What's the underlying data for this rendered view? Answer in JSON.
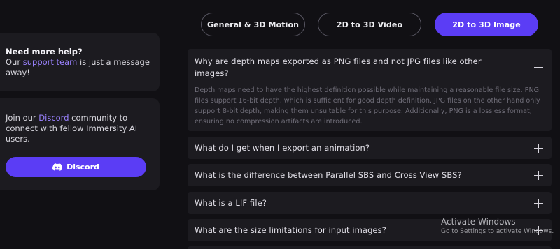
{
  "tabs": [
    {
      "label": "General & 3D Motion",
      "active": false
    },
    {
      "label": "2D to 3D Video",
      "active": false
    },
    {
      "label": "2D to 3D Image",
      "active": true
    }
  ],
  "help_card": {
    "title": "Need more help?",
    "text_before": "Our ",
    "link": "support team",
    "text_after": " is just a message away!"
  },
  "discord_card": {
    "text_before": "Join our ",
    "link": "Discord",
    "text_after": " community to connect with fellow Immersity AI users.",
    "button_label": "Discord",
    "button_icon": "discord-icon"
  },
  "faq": [
    {
      "question_line1": "Why are depth maps exported as PNG files and not JPG files like other",
      "question_line2": "images?",
      "expanded": true,
      "answer_lines": [
        "Depth maps need to have the highest definition possible while maintaining a reasonable file size. PNG",
        "files support 16-bit depth, which is sufficient for good depth definition. JPG files on the other hand only",
        "support 8-bit depth, making them unsuitable for this purpose. Additionally, PNG is a lossless format,",
        "ensuring no compression artifacts are introduced."
      ]
    },
    {
      "question": "What do I get when I export an animation?",
      "expanded": false
    },
    {
      "question": "What is the difference between Parallel SBS and Cross View SBS?",
      "expanded": false
    },
    {
      "question": "What is a LIF file?",
      "expanded": false
    },
    {
      "question": "What are the size limitations for input images?",
      "expanded": false
    }
  ],
  "watermark": {
    "title": "Activate Windows",
    "subtitle": "Go to Settings to activate Windows."
  },
  "colors": {
    "background": "#111014",
    "card": "#1c1b20",
    "accent": "#5b3df5",
    "link": "#9a82ff"
  }
}
